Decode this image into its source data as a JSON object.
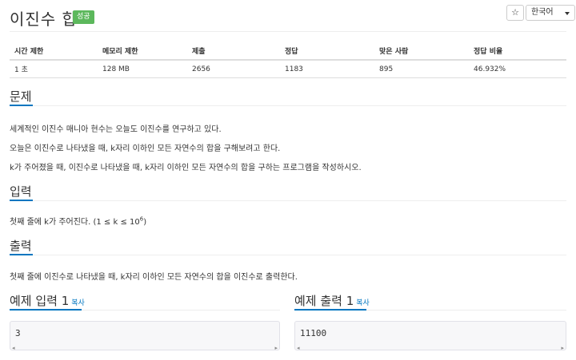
{
  "header": {
    "title": "이진수 합",
    "badge": "성공",
    "star_icon": "☆",
    "language": "한국어"
  },
  "info_table": {
    "headers": [
      "시간 제한",
      "메모리 제한",
      "제출",
      "정답",
      "맞은 사람",
      "정답 비율"
    ],
    "values": [
      "1 초",
      "128 MB",
      "2656",
      "1183",
      "895",
      "46.932%"
    ]
  },
  "problem": {
    "title": "문제",
    "lines": [
      "세계적인 이진수 매니아 현수는 오늘도 이진수를 연구하고 있다.",
      "오늘은 이진수로 나타냈을 때, k자리 이하인 모든 자연수의 합을 구해보려고 한다.",
      "k가 주어졌을 때, 이진수로 나타냈을 때, k자리 이하인 모든 자연수의 합을 구하는 프로그램을 작성하시오."
    ]
  },
  "input": {
    "title": "입력",
    "text": "첫째 줄에 k가 주어진다. (1 ≤ k ≤ 10",
    "sup": "6",
    "text_end": ")"
  },
  "output": {
    "title": "출력",
    "text": "첫째 줄에 이진수로 나타냈을 때, k자리 이하인 모든 자연수의 합을 이진수로 출력한다."
  },
  "examples": {
    "input_title": "예제 입력 1",
    "output_title": "예제 출력 1",
    "copy_label": "복사",
    "input_value": "3",
    "output_value": "11100"
  },
  "colors": {
    "accent": "#0076c0",
    "success": "#5cb85c"
  }
}
